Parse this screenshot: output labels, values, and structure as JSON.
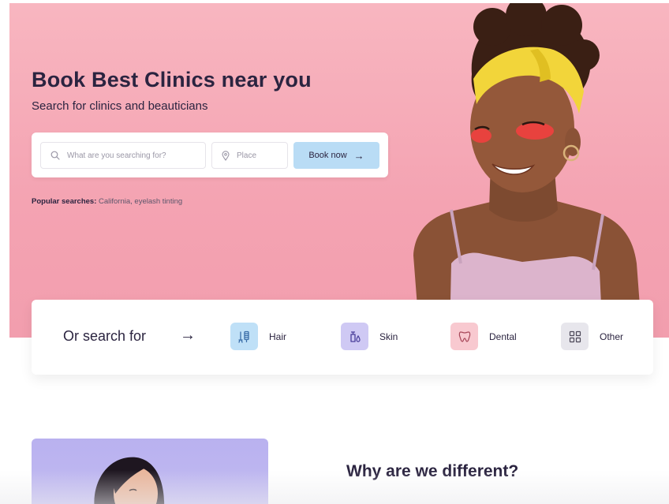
{
  "hero": {
    "title": "Book Best Clinics near you",
    "subtitle": "Search for clinics and beauticians",
    "background_color": "#f4a3b2"
  },
  "search": {
    "what_placeholder": "What are you searching for?",
    "place_placeholder": "Place",
    "book_label": "Book now",
    "book_arrow": "→",
    "book_color": "#b9dcf5",
    "what_icon": "search-icon",
    "place_icon": "location-pin-icon"
  },
  "popular": {
    "label": "Popular searches:",
    "terms": "California, eyelash tinting"
  },
  "categories": {
    "heading": "Or search for",
    "arrow": "→",
    "items": [
      {
        "label": "Hair",
        "icon": "hair-tools-icon",
        "color": "#bfe0f7"
      },
      {
        "label": "Skin",
        "icon": "skin-bottle-icon",
        "color": "#cfc9f4"
      },
      {
        "label": "Dental",
        "icon": "tooth-icon",
        "color": "#f8c9d0"
      },
      {
        "label": "Other",
        "icon": "grid-icon",
        "color": "#e7e6ec"
      }
    ]
  },
  "section": {
    "why_title": "Why are we different?",
    "promo_color": "#b9b1ef"
  }
}
